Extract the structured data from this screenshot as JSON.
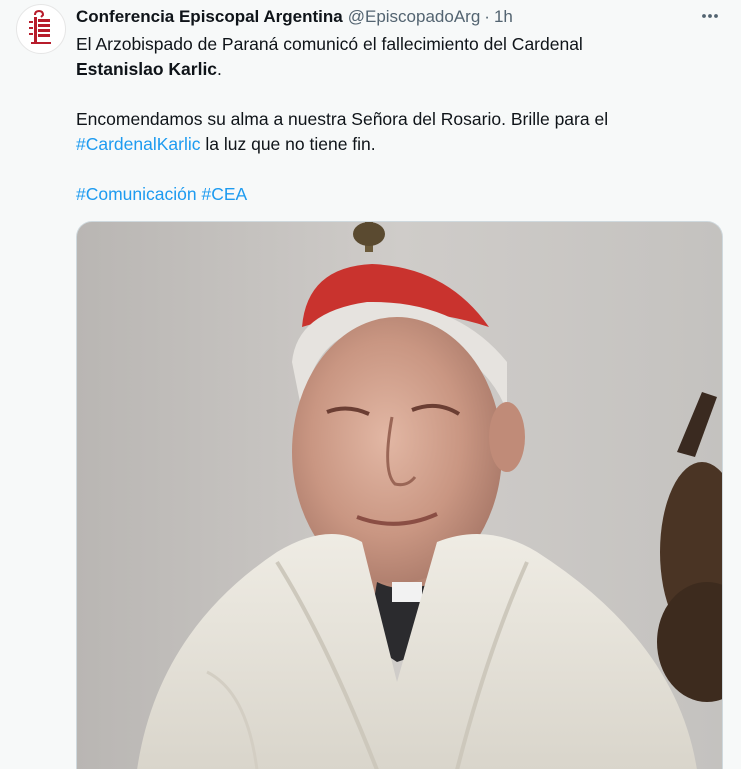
{
  "tweet": {
    "author": {
      "display_name": "Conferencia Episcopal Argentina",
      "handle": "@EpiscopadoArg",
      "separator": "·",
      "time": "1h"
    },
    "more_icon": "more-horizontal-icon",
    "text": {
      "line1": "El Arzobispado de Paraná comunicó el fallecimiento del Cardenal",
      "name_bold": "Estanislao Karlic",
      "period": ".",
      "para2_part1": "Encomendamos su alma a nuestra Señora del Rosario. Brille para el",
      "hashtag_cardenal": "#CardenalKarlic",
      "para2_part2": " la luz que no tiene fin.",
      "hashtag_comunicacion": "#Comunicación",
      "hashtag_cea": "#CEA"
    },
    "colors": {
      "background": "#F7F9F9",
      "text": "#0F1419",
      "secondary": "#536471",
      "link": "#1D9BF0",
      "logo": "#B71C2B"
    }
  }
}
